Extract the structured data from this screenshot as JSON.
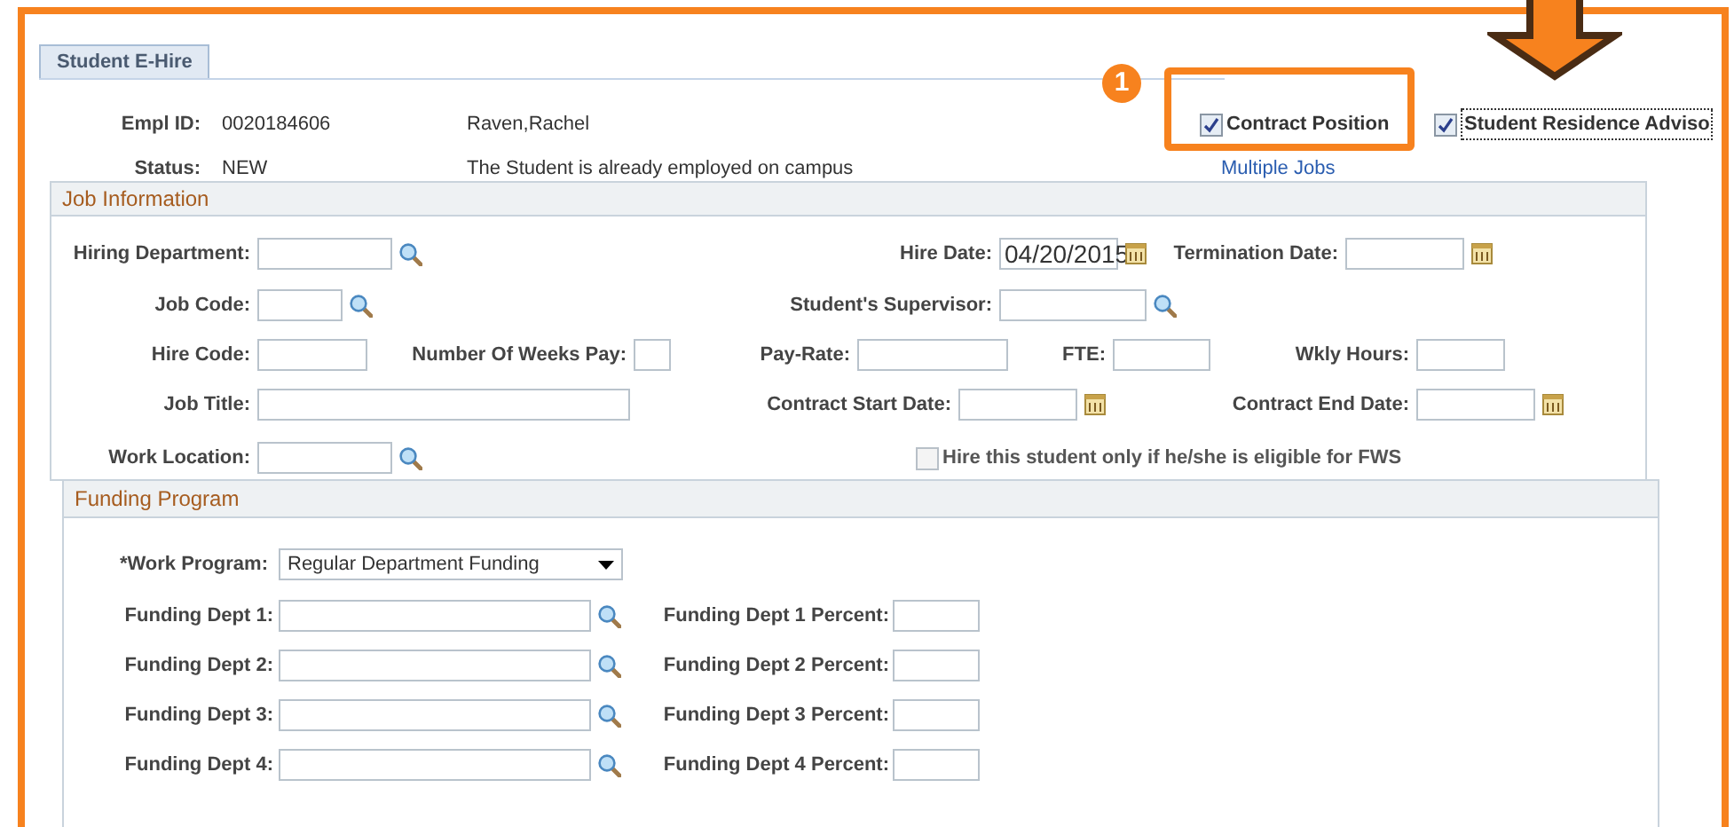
{
  "tabs": [
    {
      "label": "Student E-Hire",
      "selected": true
    }
  ],
  "callout": {
    "number": "1"
  },
  "header": {
    "empl_id_label": "Empl ID:",
    "empl_id": "0020184606",
    "name": "Raven,Rachel",
    "status_label": "Status:",
    "status": "NEW",
    "status_message": "The Student is already employed on campus",
    "multiple_jobs_link": "Multiple Jobs"
  },
  "checkboxes": [
    {
      "label": "Contract Position",
      "checked": true,
      "highlighted": true
    },
    {
      "label": "Student Residence Adviso",
      "checked": true,
      "highlighted": false
    }
  ],
  "job_information": {
    "title": "Job Information",
    "fields": [
      {
        "label": "Hiring Department:",
        "kind": "lookup"
      },
      {
        "label": "Hire Date:",
        "kind": "date",
        "value": "04/20/2015"
      },
      {
        "label": "Termination Date:",
        "kind": "date"
      },
      {
        "label": "Job Code:",
        "kind": "lookup"
      },
      {
        "label": "Student's Supervisor:",
        "kind": "lookup"
      },
      {
        "label": "Hire Code:",
        "kind": "text"
      },
      {
        "label": "Number Of Weeks Pay:",
        "kind": "text"
      },
      {
        "label": "Pay-Rate:",
        "kind": "text"
      },
      {
        "label": "FTE:",
        "kind": "text"
      },
      {
        "label": "Wkly Hours:",
        "kind": "text"
      },
      {
        "label": "Job Title:",
        "kind": "text"
      },
      {
        "label": "Contract Start Date:",
        "kind": "date"
      },
      {
        "label": "Contract End Date:",
        "kind": "date"
      },
      {
        "label": "Work Location:",
        "kind": "lookup"
      }
    ],
    "fws_checkbox": {
      "label": "Hire this student only if he/she is eligible for FWS",
      "checked": false
    }
  },
  "funding_program": {
    "title": "Funding Program",
    "work_program": {
      "label": "*Work Program:",
      "value": "Regular Department Funding"
    },
    "departments": [
      {
        "label": "Funding Dept 1:",
        "percent_label": "Funding Dept 1 Percent:"
      },
      {
        "label": "Funding Dept 2:",
        "percent_label": "Funding Dept 2 Percent:"
      },
      {
        "label": "Funding Dept 3:",
        "percent_label": "Funding Dept 3 Percent:"
      },
      {
        "label": "Funding Dept 4:",
        "percent_label": "Funding Dept 4 Percent:"
      }
    ]
  }
}
